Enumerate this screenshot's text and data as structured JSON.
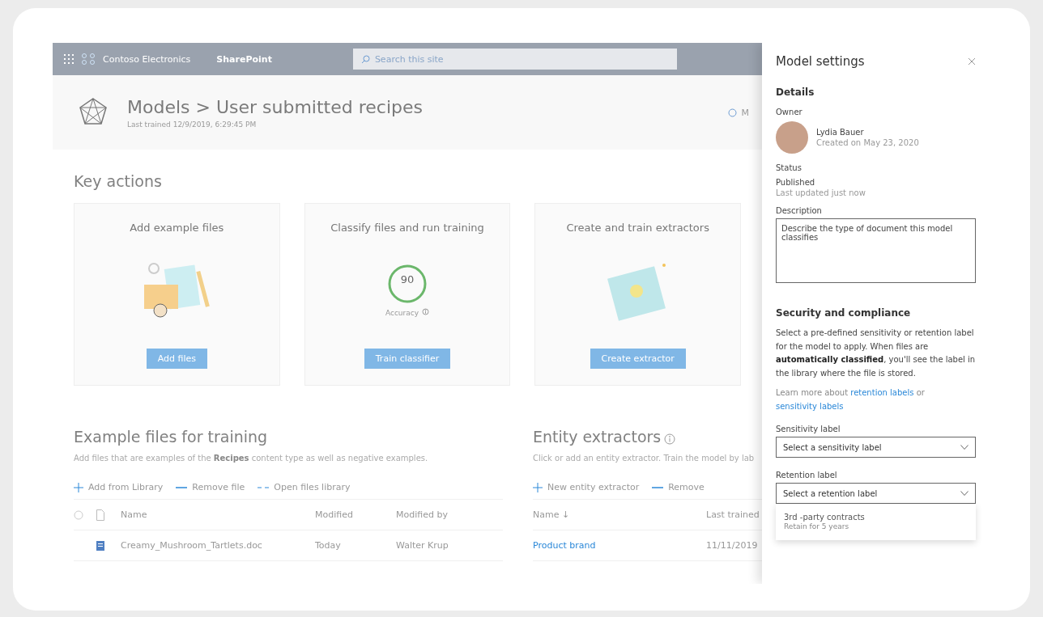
{
  "topbar": {
    "site_name": "Contoso Electronics",
    "app_name": "SharePoint",
    "search_placeholder": "Search this site"
  },
  "header": {
    "title": "Models > User submitted recipes",
    "subtitle": "Last trained 12/9/2019, 6:29:45 PM",
    "action_fragment": "M"
  },
  "key_actions": {
    "heading": "Key actions",
    "cards": [
      {
        "kind": "files",
        "title": "Add example files",
        "button": "Add files"
      },
      {
        "kind": "accuracy",
        "title": "Classify files and run training",
        "score": "90",
        "score_label": "Accuracy",
        "button": "Train classifier"
      },
      {
        "kind": "extractor",
        "title": "Create and train extractors",
        "button": "Create extractor"
      }
    ]
  },
  "example_files": {
    "heading": "Example files for training",
    "description": "Add files that are examples of the **Recipes** content type as well as negative examples.",
    "toolbar": [
      {
        "kind": "add",
        "label": "Add from Library"
      },
      {
        "kind": "remove",
        "label": "Remove file"
      },
      {
        "kind": "open",
        "label": "Open files library"
      }
    ],
    "columns": [
      "Name",
      "Modified",
      "Modified by"
    ],
    "rows": [
      {
        "name": "Creamy_Mushroom_Tartlets.doc",
        "modified": "Today",
        "modified_by": "Walter Krup"
      }
    ]
  },
  "entity_extractors": {
    "heading": "Entity extractors",
    "description": "Click or add an entity extractor. Train the model by lab",
    "toolbar": [
      {
        "kind": "add",
        "label": "New entity extractor"
      },
      {
        "kind": "remove",
        "label": "Remove"
      }
    ],
    "columns": [
      "Name ↓",
      "Last trained"
    ],
    "rows": [
      {
        "name": "Product brand",
        "last_trained": "11/11/2019"
      }
    ]
  },
  "panel": {
    "title": "Model settings",
    "details_heading": "Details",
    "owner_label": "Owner",
    "owner_name": "Lydia Bauer",
    "owner_created": "Created on May 23, 2020",
    "status_label": "Status",
    "status": "Published",
    "status_note": "Last updated just now",
    "description_label": "Description",
    "description": "Describe the type of document this model classifies",
    "security_heading": "Security and compliance",
    "security_text": "Select a pre-defined sensitivity or retention label for the model to apply. When files are **automatically classified**, you'll see the label in the library where the file is stored.",
    "learn_more_prefix": "Learn more about",
    "learn_more_links": [
      "retention labels",
      "sensitivity labels"
    ],
    "learn_more_joiner": "or",
    "sensitivity_label": "Sensitivity label",
    "sensitivity_placeholder": "Select a sensitivity label",
    "retention_label": "Retention label",
    "retention_placeholder": "Select a retention label",
    "retention_options": [
      {
        "title": "3rd -party contracts",
        "subtitle": "Retain for 5 years"
      }
    ]
  }
}
